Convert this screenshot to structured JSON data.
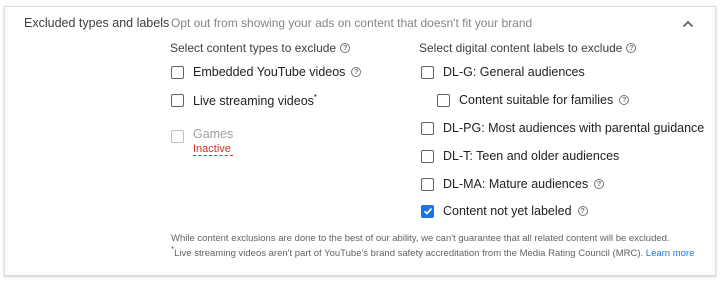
{
  "section": {
    "title": "Excluded types and labels",
    "subtitle": "Opt out from showing your ads on content that doesn't fit your brand"
  },
  "content_types": {
    "heading": "Select content types to exclude",
    "items": [
      {
        "label": "Embedded YouTube videos",
        "checked": false,
        "help": true
      },
      {
        "label": "Live streaming videos",
        "suffix": "*",
        "checked": false,
        "help": false
      },
      {
        "label": "Games",
        "checked": false,
        "disabled": true,
        "status": "Inactive"
      }
    ]
  },
  "content_labels": {
    "heading": "Select digital content labels to exclude",
    "items": [
      {
        "label": "DL-G: General audiences",
        "checked": false,
        "help": false
      },
      {
        "label": "Content suitable for families",
        "checked": false,
        "help": true,
        "indent": true
      },
      {
        "label": "DL-PG: Most audiences with parental guidance",
        "checked": false,
        "help": false
      },
      {
        "label": "DL-T: Teen and older audiences",
        "checked": false,
        "help": false
      },
      {
        "label": "DL-MA: Mature audiences",
        "checked": false,
        "help": true
      },
      {
        "label": "Content not yet labeled",
        "checked": true,
        "help": true
      }
    ]
  },
  "footer": {
    "disclaimer": "While content exclusions are done to the best of our ability, we can't guarantee that all related content will be excluded.",
    "note_marker": "*",
    "note": "Live streaming videos aren't part of YouTube's brand safety accreditation from the Media Rating Council (MRC).",
    "link": "Learn more"
  },
  "icons": {
    "collapse": "chevron-up-icon",
    "help": "help-circle-icon",
    "check": "check-icon"
  },
  "colors": {
    "accent": "#1a73e8",
    "error": "#d93025",
    "border": "#dadce0"
  }
}
